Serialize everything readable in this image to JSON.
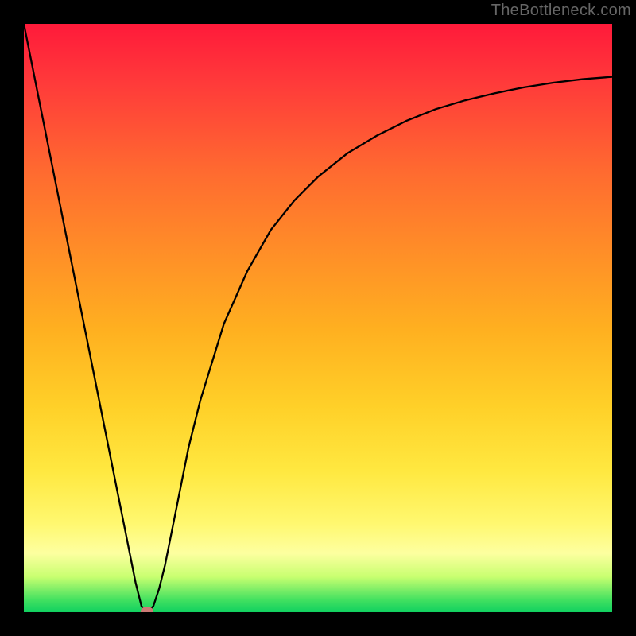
{
  "watermark": "TheBottleneck.com",
  "chart_data": {
    "type": "line",
    "title": "",
    "xlabel": "",
    "ylabel": "",
    "xlim": [
      0,
      100
    ],
    "ylim": [
      0,
      100
    ],
    "grid": false,
    "legend": false,
    "curve_x": [
      0,
      2,
      4,
      6,
      8,
      10,
      12,
      14,
      16,
      18,
      19,
      20,
      21,
      22,
      23,
      24,
      26,
      28,
      30,
      34,
      38,
      42,
      46,
      50,
      55,
      60,
      65,
      70,
      75,
      80,
      85,
      90,
      95,
      100
    ],
    "curve_y": [
      100,
      90,
      80,
      70,
      60,
      50,
      40,
      30,
      20,
      10,
      5,
      1,
      0,
      1,
      4,
      8,
      18,
      28,
      36,
      49,
      58,
      65,
      70,
      74,
      78,
      81,
      83.5,
      85.5,
      87,
      88.2,
      89.2,
      90,
      90.6,
      91
    ],
    "minimum_point": {
      "x": 21,
      "y": 0
    },
    "description": "Bottleneck percentage curve showing a sharp V-shaped minimum near x≈21 and an asymptotic rise toward ~91 at x=100, overlaid on a red-to-green vertical gradient (red=high bottleneck, green=low)."
  },
  "colors": {
    "frame": "#000000",
    "curve": "#000000",
    "marker": "#cc7a75"
  }
}
